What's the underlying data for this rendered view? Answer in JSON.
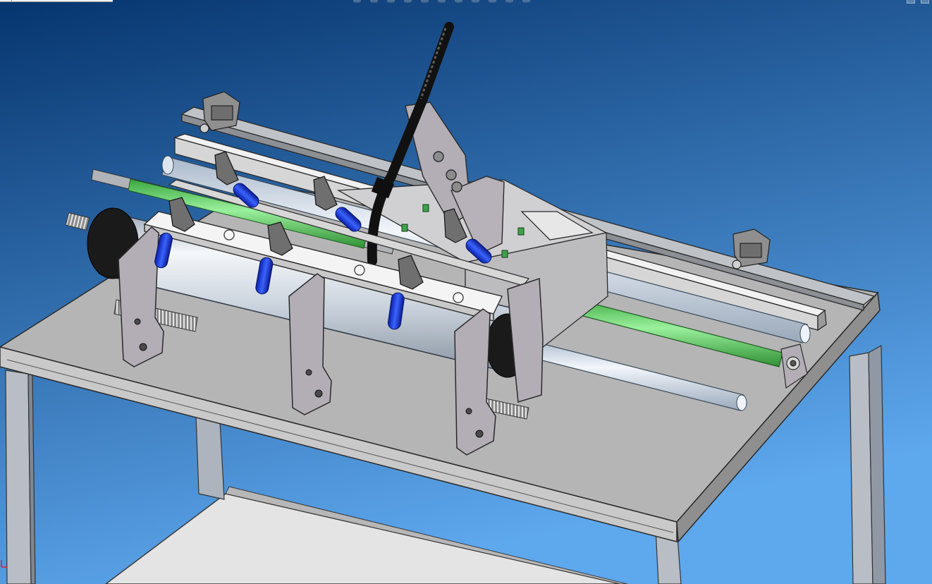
{
  "window": {
    "title": ""
  },
  "toolbar": {
    "icons": [
      "zoom-to-fit-icon",
      "zoom-area-icon",
      "previous-view-icon",
      "section-view-icon",
      "view-orientation-icon",
      "display-style-icon",
      "hide-show-items-icon",
      "edit-appearance-icon",
      "apply-scene-icon",
      "view-settings-icon",
      "realview-icon"
    ]
  },
  "window_controls": [
    "restore-icon",
    "close-icon"
  ],
  "colors": {
    "background_top": "#06356e",
    "background_bottom": "#5ea8ee",
    "table_top": "#b5b5b5",
    "frame_steel": "#c2c6cc",
    "bracket_steel": "#b3aeb5",
    "clamp_handle": "#1236e0",
    "rod_green": "#62d867",
    "rod_silver": "#cfdbeb",
    "cylinder_body": "#d3dce6",
    "cylinder_cap": "#1a1a1a",
    "cable_black": "#1b1b1b"
  },
  "model": {
    "components": [
      "table-top",
      "table-leg",
      "lower-shelf",
      "rail-beam",
      "guide-rod-silver",
      "guide-rod-green",
      "pneumatic-cylinder",
      "end-cap",
      "support-bracket",
      "toggle-clamp",
      "clamp-handle",
      "center-plate",
      "cable",
      "spring-rod",
      "adjustable-stop"
    ]
  }
}
